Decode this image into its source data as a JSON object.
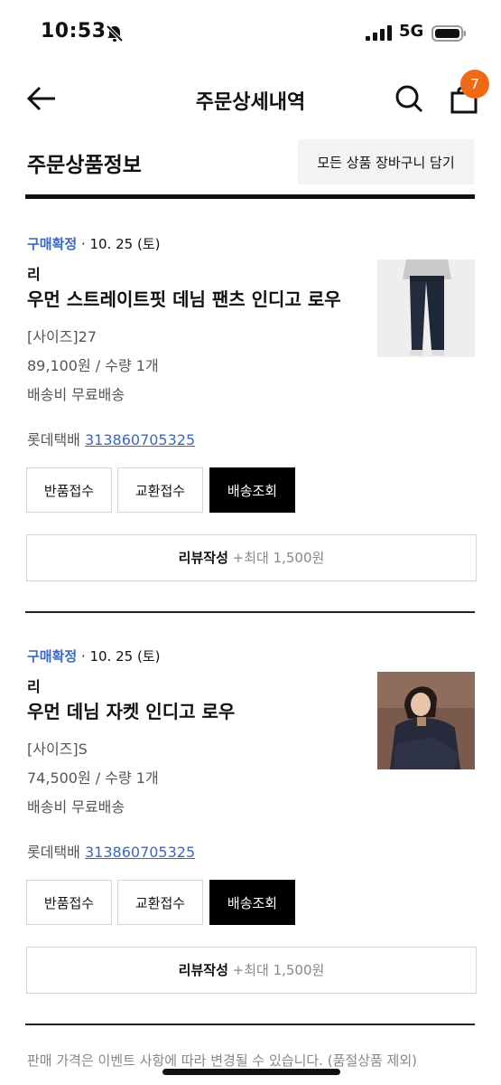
{
  "status_bar": {
    "time": "10:53",
    "network": "5G"
  },
  "header": {
    "title": "주문상세내역",
    "cart_count": "7"
  },
  "section": {
    "title": "주문상품정보",
    "add_all_to_cart": "모든 상품 장바구니 담기"
  },
  "items": [
    {
      "status": "구매확정",
      "date": " · 10. 25 (토)",
      "brand": "리",
      "name": "우먼 스트레이트핏 데님 팬츠 인디고 로우",
      "option": "[사이즈]27",
      "price_qty": "89,100원 / 수량 1개",
      "shipping": "배송비 무료배송",
      "courier": "롯데택배",
      "tracking": "313860705325",
      "btn_return": "반품접수",
      "btn_exchange": "교환접수",
      "btn_track": "배송조회",
      "review_label": "리뷰작성",
      "review_bonus": " +최대 1,500원"
    },
    {
      "status": "구매확정",
      "date": " · 10. 25 (토)",
      "brand": "리",
      "name": "우먼 데님 자켓 인디고 로우",
      "option": "[사이즈]S",
      "price_qty": "74,500원 / 수량 1개",
      "shipping": "배송비 무료배송",
      "courier": "롯데택배",
      "tracking": "313860705325",
      "btn_return": "반품접수",
      "btn_exchange": "교환접수",
      "btn_track": "배송조회",
      "review_label": "리뷰작성",
      "review_bonus": " +최대 1,500원"
    }
  ],
  "footer": {
    "note": "판매 가격은 이벤트 사항에 따라 변경될 수 있습니다. (품절상품 제외)"
  },
  "icons": [
    "back-arrow-icon",
    "search-icon",
    "shopping-bag-icon",
    "bell-slash-icon",
    "signal-icon",
    "battery-icon"
  ],
  "colors": {
    "accent_blue": "#3b67c4",
    "badge_orange": "#f06a16"
  }
}
